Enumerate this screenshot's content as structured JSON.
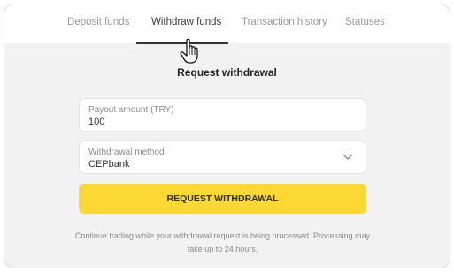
{
  "tabs": [
    {
      "label": "Deposit funds",
      "active": false
    },
    {
      "label": "Withdraw funds",
      "active": true
    },
    {
      "label": "Transaction history",
      "active": false
    },
    {
      "label": "Statuses",
      "active": false
    }
  ],
  "form": {
    "heading": "Request withdrawal",
    "payout": {
      "label": "Payout amount (TRY)",
      "value": "100"
    },
    "method": {
      "label": "Withdrawal method",
      "value": "CEPbank"
    },
    "submit_label": "REQUEST WITHDRAWAL",
    "note_line1": "Continue trading while your withdrawal request is being processed.  Processing may",
    "note_line2": "take up to 24 hours."
  },
  "colors": {
    "accent_button": "#fcd835",
    "page_background": "#f2f2f2",
    "active_tab_underline": "#333333"
  },
  "icons": {
    "cursor": "hand-pointer-icon",
    "dropdown": "chevron-down-icon"
  }
}
